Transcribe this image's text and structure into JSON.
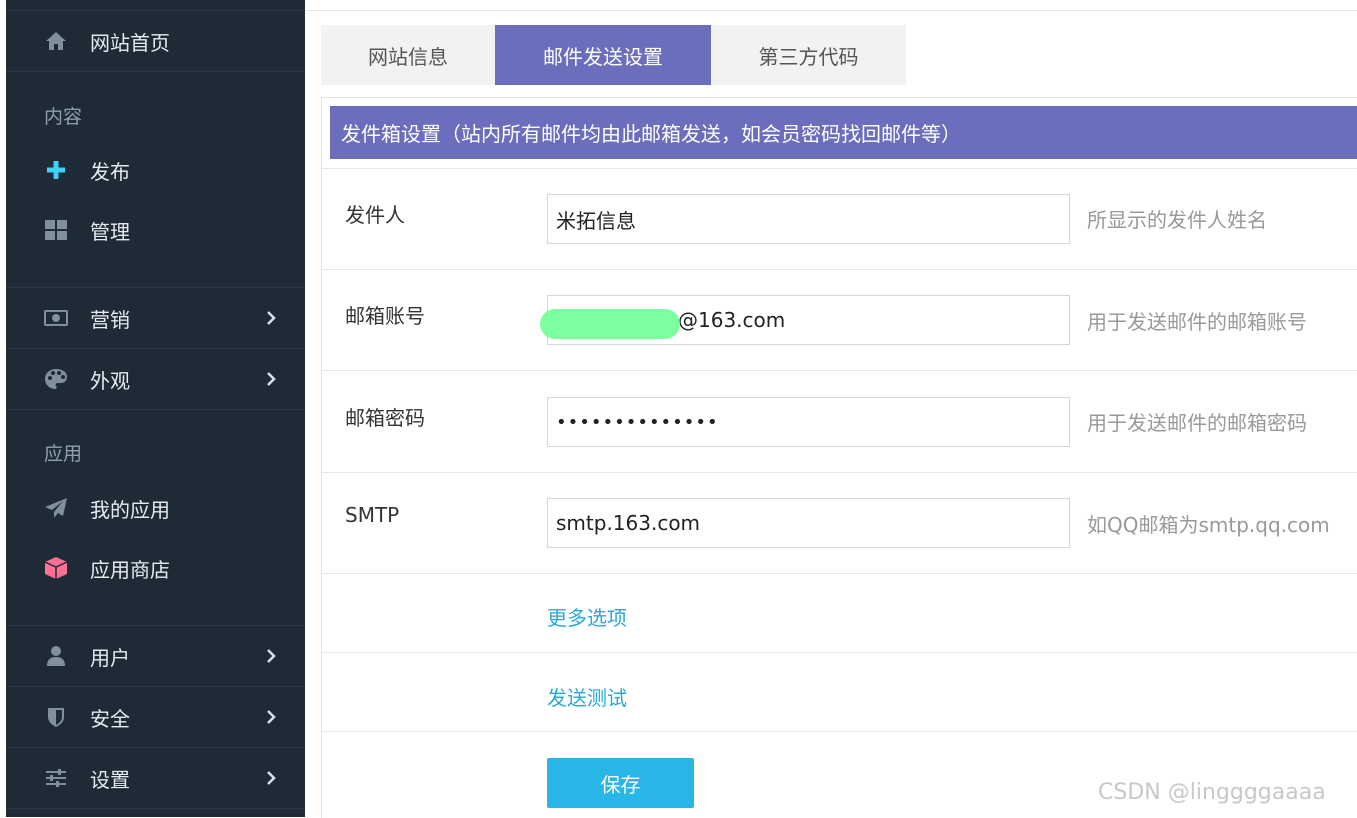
{
  "sidebar": {
    "home_label": "网站首页",
    "section_content": "内容",
    "publish_label": "发布",
    "manage_label": "管理",
    "marketing_label": "营销",
    "appearance_label": "外观",
    "section_apps": "应用",
    "my_apps_label": "我的应用",
    "app_store_label": "应用商店",
    "users_label": "用户",
    "security_label": "安全",
    "settings_label": "设置"
  },
  "tabs": [
    {
      "label": "网站信息",
      "active": false
    },
    {
      "label": "邮件发送设置",
      "active": true
    },
    {
      "label": "第三方代码",
      "active": false
    }
  ],
  "banner": "发件箱设置（站内所有邮件均由此邮箱发送，如会员密码找回邮件等）",
  "form": {
    "sender_label": "发件人",
    "sender_value": "米拓信息",
    "sender_hint": "所显示的发件人姓名",
    "email_label": "邮箱账号",
    "email_value": "@163.com",
    "email_hint": "用于发送邮件的邮箱账号",
    "password_label": "邮箱密码",
    "password_value": "••••••••••••••",
    "password_hint": "用于发送邮件的邮箱密码",
    "smtp_label": "SMTP",
    "smtp_value": "smtp.163.com",
    "smtp_hint": "如QQ邮箱为smtp.qq.com",
    "more_options": "更多选项",
    "send_test": "发送测试",
    "save": "保存"
  },
  "watermark": "CSDN @linggggaaaa",
  "colors": {
    "sidebar_bg": "#1e2a36",
    "accent": "#6b6ebd",
    "save_button": "#27b6e6",
    "link": "#29a8d8"
  }
}
